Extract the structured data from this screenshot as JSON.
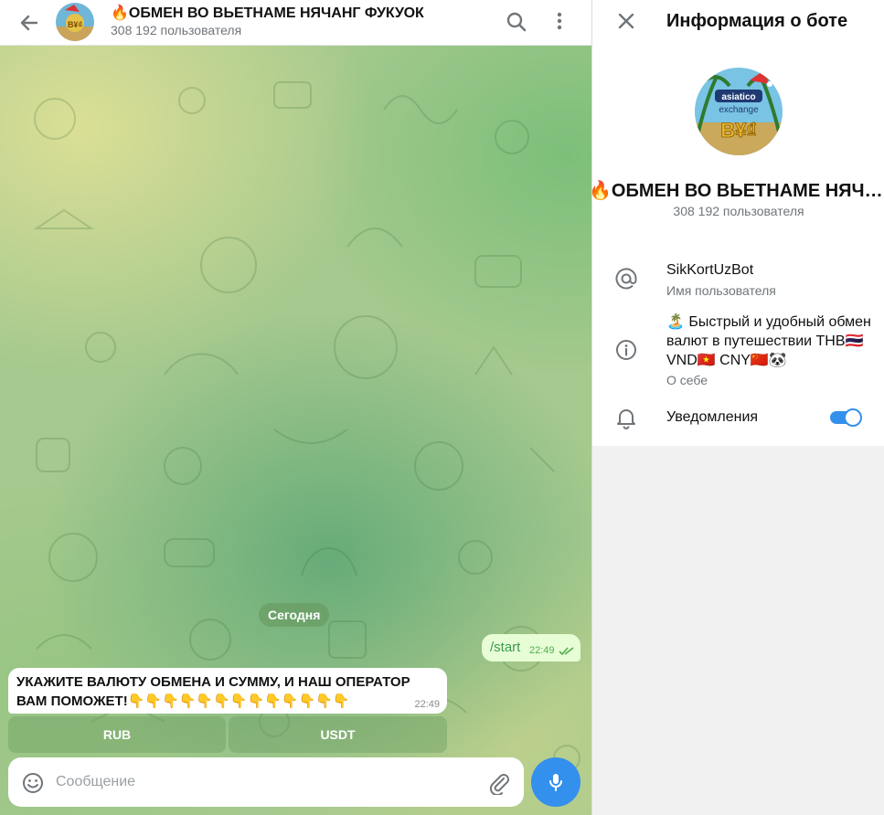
{
  "header": {
    "title": "🔥ОБМЕН ВО ВЬЕТНАМЕ НЯЧАНГ ФУКУОК",
    "subtitle": "308 192 пользователя"
  },
  "chat": {
    "date_separator": "Сегодня",
    "outgoing": {
      "text": "/start",
      "time": "22:49"
    },
    "incoming": {
      "text": "УКАЖИТЕ ВАЛЮТУ ОБМЕНА И СУММУ, И НАШ ОПЕРАТОР ВАМ ПОМОЖЕТ!👇👇👇👇👇👇👇👇👇👇👇👇👇",
      "time": "22:49"
    },
    "keyboard": [
      {
        "label": "RUB"
      },
      {
        "label": "USDT"
      }
    ],
    "composer": {
      "placeholder": "Сообщение",
      "value": ""
    }
  },
  "info": {
    "title": "Информация о боте",
    "name": "🔥ОБМЕН ВО ВЬЕТНАМЕ НЯЧАНГ ФУКУОК",
    "count": "308 192 пользователя",
    "avatar_text": {
      "line1": "asiatico",
      "line2": "exchange",
      "symbols": "B¥₫"
    },
    "username": {
      "value": "SikKortUzBot",
      "label": "Имя пользователя"
    },
    "bio": {
      "value": "🏝️ Быстрый и удобный обмен валют в путешествии THB🇹🇭 VND🇻🇳 CNY🇨🇳🐼",
      "label": "О себе"
    },
    "notifications": {
      "label": "Уведомления",
      "enabled": true
    }
  },
  "colors": {
    "accent": "#3390ec",
    "out_bubble": "#e7fdd6",
    "out_text": "#3d9a51"
  }
}
